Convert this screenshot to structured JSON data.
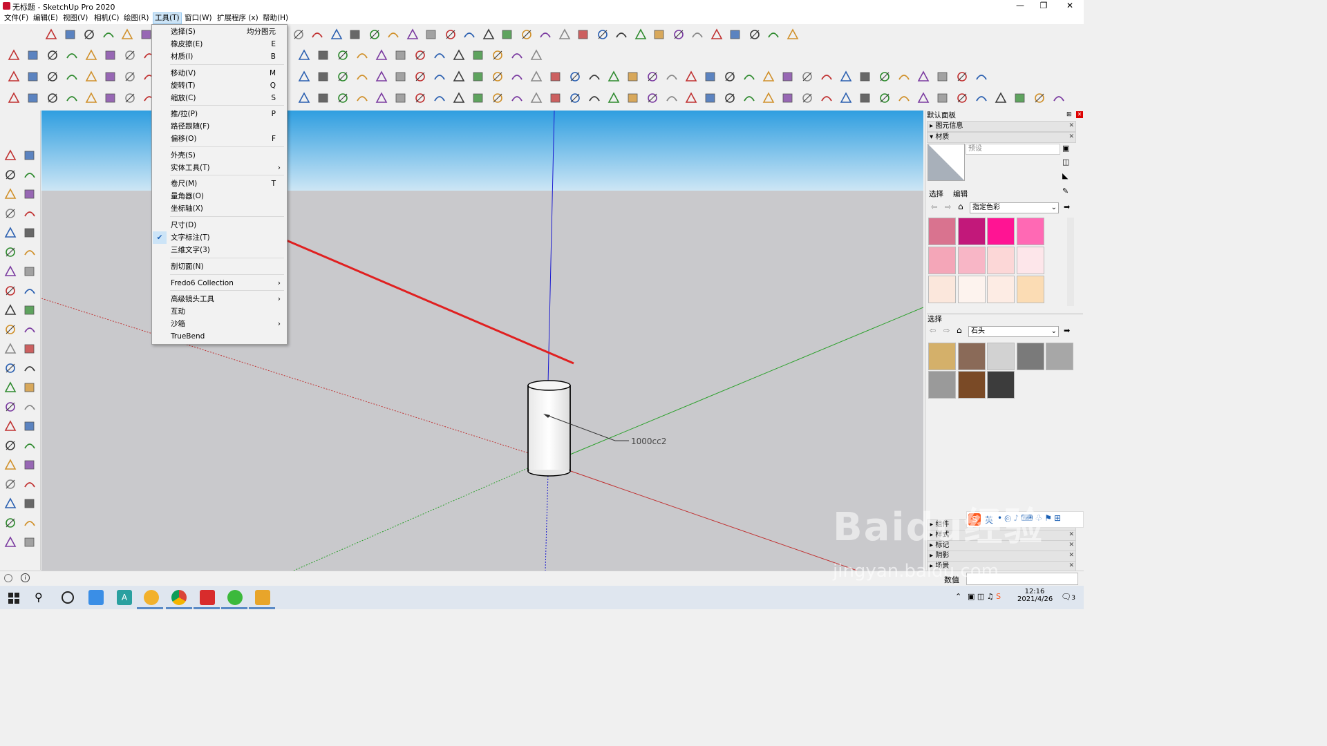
{
  "window": {
    "title": "无标题 - SketchUp Pro 2020",
    "controls": [
      "—",
      "❐",
      "✕"
    ]
  },
  "menubar": [
    {
      "label": "文件(F)"
    },
    {
      "label": "编辑(E)"
    },
    {
      "label": "视图(V)"
    },
    {
      "label": "相机(C)"
    },
    {
      "label": "绘图(R)"
    },
    {
      "label": "工具(T)",
      "active": true
    },
    {
      "label": "窗口(W)"
    },
    {
      "label": "扩展程序 (x)"
    },
    {
      "label": "帮助(H)"
    }
  ],
  "tools_menu": {
    "items": [
      {
        "label": "选择(S)",
        "shortcut": "均分图元"
      },
      {
        "label": "橡皮擦(E)",
        "shortcut": "E"
      },
      {
        "label": "材质(I)",
        "shortcut": "B"
      },
      {
        "label": "移动(V)",
        "shortcut": "M"
      },
      {
        "label": "旋转(T)",
        "shortcut": "Q"
      },
      {
        "label": "缩放(C)",
        "shortcut": "S"
      },
      {
        "label": "推/拉(P)",
        "shortcut": "P"
      },
      {
        "label": "路径跟随(F)",
        "shortcut": ""
      },
      {
        "label": "偏移(O)",
        "shortcut": "F"
      },
      {
        "label": "外壳(S)",
        "shortcut": ""
      },
      {
        "label": "实体工具(T)",
        "submenu": "›"
      },
      {
        "label": "卷尺(M)",
        "shortcut": "T"
      },
      {
        "label": "量角器(O)",
        "shortcut": ""
      },
      {
        "label": "坐标轴(X)",
        "shortcut": ""
      },
      {
        "label": "尺寸(D)",
        "shortcut": ""
      },
      {
        "label": "文字标注(T)",
        "checked": "✔"
      },
      {
        "label": "三维文字(3)",
        "shortcut": ""
      },
      {
        "label": "剖切面(N)",
        "shortcut": ""
      },
      {
        "label": "Fredo6 Collection",
        "submenu": "›"
      },
      {
        "label": "高级镜头工具",
        "submenu": "›"
      },
      {
        "label": "互动",
        "shortcut": ""
      },
      {
        "label": "沙箱",
        "submenu": "›"
      },
      {
        "label": "TrueBend",
        "shortcut": ""
      }
    ]
  },
  "viewport": {
    "annotation_text": "1000cc2",
    "sky_color": "#4aa7e1",
    "ground_color": "#c8c8c8",
    "arrow_color": "#e02020"
  },
  "right_panel": {
    "title": "默认面板",
    "entity_info": "图元信息",
    "materials": "材质",
    "preset_placeholder": "预设",
    "tab_select": "选择",
    "tab_edit": "编辑",
    "collection1": "指定色彩",
    "section_select": "选择",
    "collection2": "石头",
    "swatches1": [
      "#d9738f",
      "#c2187a",
      "#ff1493",
      "#ff69b4",
      "#f4a6b8",
      "#f8b6c6",
      "#fcd7d7",
      "#fde6ea",
      "#fbe7dc",
      "#fdf3ee",
      "#fdece4",
      "#fbdcb4"
    ],
    "swatches2": [
      "#d4b06a",
      "#8a6a58",
      "#d2d2d2",
      "#7a7a7a",
      "#a7a7a7",
      "#9a9a9a",
      "#7a4a26",
      "#3c3c3c"
    ],
    "collapsed": [
      "组件",
      "样式",
      "标记",
      "阴影",
      "场景"
    ],
    "value_label": "数值"
  },
  "taskbar": {
    "time": "12:16",
    "date": "2021/4/26",
    "notif_count": "3"
  },
  "overlay": {
    "ime_label": "英",
    "watermark": "Baidu经验",
    "watermark_url": "jingyan.baidu.com"
  }
}
